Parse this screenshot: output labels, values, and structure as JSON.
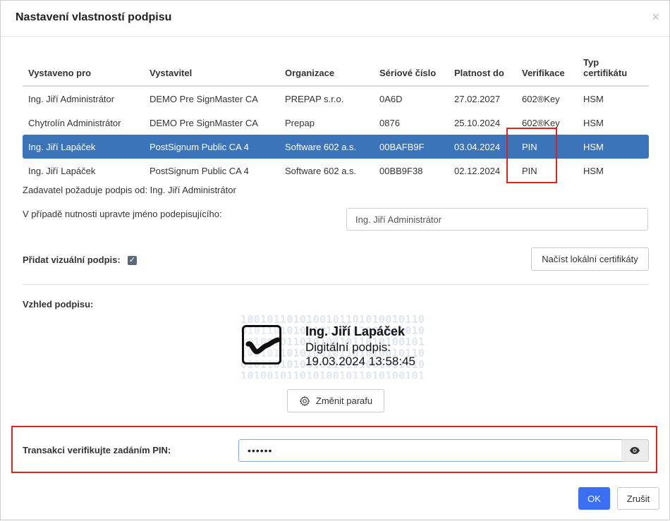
{
  "dialog": {
    "title": "Nastavení vlastností podpisu",
    "close_glyph": "×"
  },
  "table": {
    "headers": [
      "Vystaveno pro",
      "Vystavitel",
      "Organizace",
      "Sériové číslo",
      "Platnost do",
      "Verifikace",
      "Typ certifikátu"
    ],
    "rows": [
      [
        "Ing. Jiří Administrátor",
        "DEMO Pre SignMaster CA",
        "PREPAP s.r.o.",
        "0A6D",
        "27.02.2027",
        "602®Key",
        "HSM"
      ],
      [
        "Chytrolín Administrátor",
        "DEMO Pre SignMaster CA",
        "Prepap",
        "0876",
        "25.10.2024",
        "602®Key",
        "HSM"
      ],
      [
        "Ing. Jiří Lapáček",
        "PostSignum Public CA 4",
        "Software 602 a.s.",
        "00BAFB9F",
        "03.04.2024",
        "PIN",
        "HSM"
      ],
      [
        "Ing. Jiří Lapáček",
        "PostSignum Public CA 4",
        "Software 602 a.s.",
        "00BB9F38",
        "02.12.2024",
        "PIN",
        "HSM"
      ]
    ],
    "selected_row": 2,
    "selection_color": "#3b74b8"
  },
  "requester": {
    "text": "Zadavatel požaduje podpis od: Ing. Jiří Administrátor"
  },
  "signer_name": {
    "label": "V případě nutnosti upravte jméno podepisujícího:",
    "value": "Ing. Jiří Administrátor"
  },
  "visual_signature": {
    "label": "Přidat vizuální podpis:",
    "checked": true,
    "check_glyph": "✓"
  },
  "load_certs_button": "Načíst lokální certifikáty",
  "appearance": {
    "label": "Vzhled podpisu:",
    "name": "Ing. Jiří Lapáček",
    "line2": "Digitální podpis:",
    "line3": "19.03.2024 13:58:45"
  },
  "change_paraph_button": "Změnit parafu",
  "pin": {
    "label": "Transakci verifikujte zadáním PIN:",
    "value": "••••••"
  },
  "footer": {
    "ok": "OK",
    "cancel": "Zrušit"
  },
  "colors": {
    "primary": "#3b6ff3",
    "highlight": "#e02020"
  },
  "icons": {
    "close": "close-icon",
    "check": "check-icon",
    "gear": "gear-icon",
    "eye": "eye-icon",
    "signature": "signature-icon"
  }
}
